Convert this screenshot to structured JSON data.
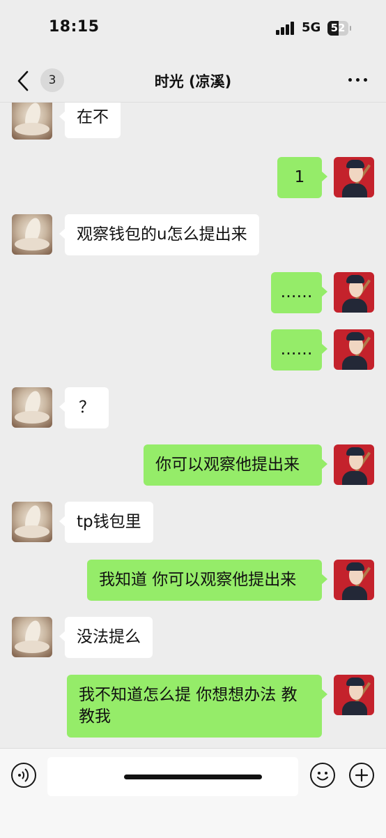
{
  "status_bar": {
    "time": "18:15",
    "network": "5G",
    "battery": "52",
    "battery_level": 0.52
  },
  "header": {
    "back_badge": "3",
    "title": "时光 (凉溪)"
  },
  "colors": {
    "background": "#ededed",
    "bubble_sent": "#95ec69",
    "bubble_received": "#ffffff"
  },
  "messages": [
    {
      "side": "left",
      "text": "在不"
    },
    {
      "side": "right",
      "text": "1"
    },
    {
      "side": "left",
      "text": "观察钱包的u怎么提出来"
    },
    {
      "side": "right",
      "text": "……"
    },
    {
      "side": "right",
      "text": "……"
    },
    {
      "side": "left",
      "text": "？"
    },
    {
      "side": "right",
      "text": "你可以观察他提出来"
    },
    {
      "side": "left",
      "text": "tp钱包里"
    },
    {
      "side": "right",
      "text": "我知道 你可以观察他提出来"
    },
    {
      "side": "left",
      "text": "没法提么"
    },
    {
      "side": "right",
      "text": "我不知道怎么提 你想想办法 教教我"
    }
  ],
  "input_bar": {
    "voice_icon": "voice-icon",
    "emoji_icon": "emoji-icon",
    "plus_icon": "plus-icon",
    "placeholder": ""
  }
}
